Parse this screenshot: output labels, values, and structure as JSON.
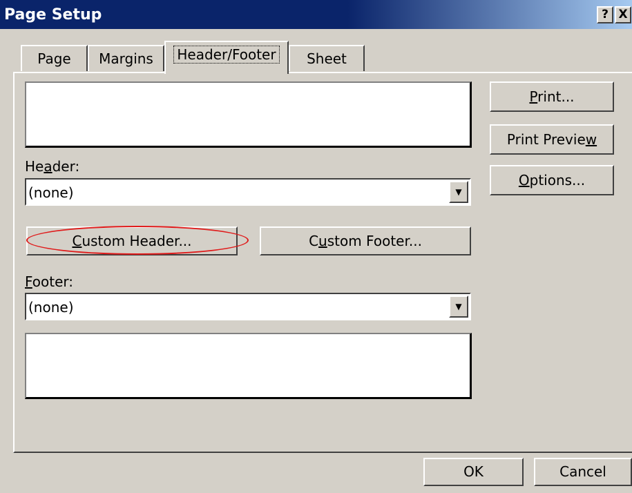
{
  "window": {
    "title": "Page Setup",
    "help_label": "?",
    "close_label": "X"
  },
  "tabs": [
    {
      "label": "Page"
    },
    {
      "label": "Margins"
    },
    {
      "label": "Header/Footer",
      "active": true
    },
    {
      "label": "Sheet"
    }
  ],
  "header": {
    "label_pre": "He",
    "label_u": "a",
    "label_post": "der:",
    "value": "(none)"
  },
  "footer": {
    "label_u": "F",
    "label_post": "ooter:",
    "value": "(none)"
  },
  "buttons": {
    "custom_header": {
      "u": "C",
      "rest": "ustom Header..."
    },
    "custom_footer": {
      "pre": "C",
      "u": "u",
      "rest": "stom Footer..."
    },
    "print": {
      "u": "P",
      "rest": "rint..."
    },
    "print_preview": {
      "pre": "Print Previe",
      "u": "w"
    },
    "options": {
      "u": "O",
      "rest": "ptions..."
    },
    "ok": "OK",
    "cancel": "Cancel"
  },
  "highlight": {
    "color": "#e01a1a",
    "target": "custom-header-button"
  },
  "icons": {
    "dropdown": "triangle-down-icon"
  }
}
